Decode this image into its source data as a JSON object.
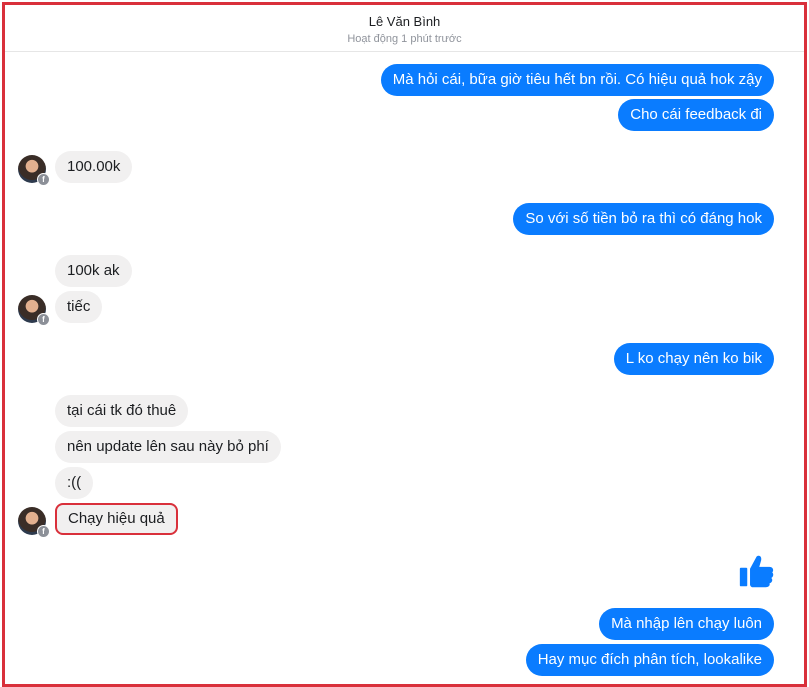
{
  "header": {
    "contact_name": "Lê Văn Bình",
    "status": "Hoạt động 1 phút trước"
  },
  "messages": [
    {
      "side": "out",
      "text": "Mà hỏi cái, bữa giờ tiêu hết bn rồi. Có hiệu quả hok zậy"
    },
    {
      "side": "out",
      "text": "Cho cái feedback đi"
    },
    {
      "side": "in",
      "text": "100.00k"
    },
    {
      "side": "out",
      "text": "So với số tiền bỏ ra thì có đáng hok"
    },
    {
      "side": "in",
      "text": "100k ak"
    },
    {
      "side": "in",
      "text": "tiếc"
    },
    {
      "side": "out",
      "text": "L ko chạy nên ko bik"
    },
    {
      "side": "in",
      "text": "tại cái tk đó thuê"
    },
    {
      "side": "in",
      "text": "nên update lên sau này bỏ phí"
    },
    {
      "side": "in",
      "text": ":(("
    },
    {
      "side": "in",
      "text": "Chạy hiệu quả",
      "highlighted": true
    },
    {
      "side": "out",
      "text": "Mà nhập lên chạy luôn"
    },
    {
      "side": "out",
      "text": "Hay mục đích phân tích, lookalike"
    }
  ],
  "icons": {
    "avatar": "contact-avatar",
    "badge": "facebook-badge-icon",
    "reaction": "thumbs-up-icon"
  },
  "colors": {
    "outgoing_bubble": "#0a7cff",
    "incoming_bubble": "#f1f0f0",
    "highlight_border": "#d9303b",
    "like": "#0a7cff"
  }
}
